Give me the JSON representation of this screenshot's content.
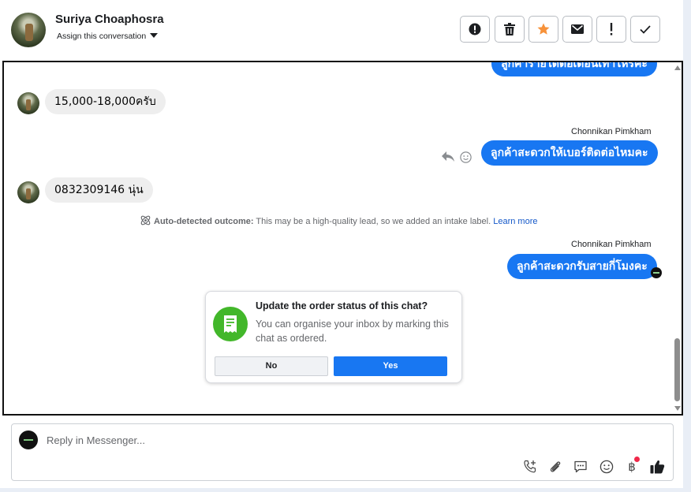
{
  "header": {
    "contact_name": "Suriya Choaphosra",
    "assign_label": "Assign this conversation",
    "toolbar": [
      {
        "icon": "alert-circle-icon",
        "label": "Mark as spam"
      },
      {
        "icon": "trash-icon",
        "label": "Delete"
      },
      {
        "icon": "star-icon",
        "label": "Follow up",
        "color": "#f7923a"
      },
      {
        "icon": "envelope-icon",
        "label": "Mark as unread"
      },
      {
        "icon": "exclamation-icon",
        "label": "Mark as important"
      },
      {
        "icon": "check-icon",
        "label": "Mark as done"
      }
    ]
  },
  "messages": {
    "partial_top_outgoing": "ลูกค้ารายได้ต่อเดือนเท่าไหร่คะ",
    "incoming_1": "15,000-18,000ครับ",
    "sender_1": "Chonnikan Pimkham",
    "outgoing_1": "ลูกค้าสะดวกให้เบอร์ติดต่อไหมคะ",
    "incoming_2": "0832309146 นุ่น",
    "outcome_label": "Auto-detected outcome:",
    "outcome_text": " This may be a high-quality lead, so we added an intake label. ",
    "outcome_link": "Learn more",
    "sender_2": "Chonnikan Pimkham",
    "outgoing_2": "ลูกค้าสะดวกรับสายกี่โมงคะ"
  },
  "order_card": {
    "title": "Update the order status of this chat?",
    "body": "You can organise your inbox by marking this chat as ordered.",
    "no_label": "No",
    "yes_label": "Yes"
  },
  "composer": {
    "placeholder": "Reply in Messenger...",
    "icons": [
      "phone-add-icon",
      "paperclip-icon",
      "saved-reply-icon",
      "emoji-icon",
      "baht-icon",
      "thumbs-up-icon"
    ],
    "baht_symbol": "฿"
  },
  "colors": {
    "accent": "#1877f2",
    "card_icon_bg": "#42b72a",
    "star": "#f7923a"
  }
}
